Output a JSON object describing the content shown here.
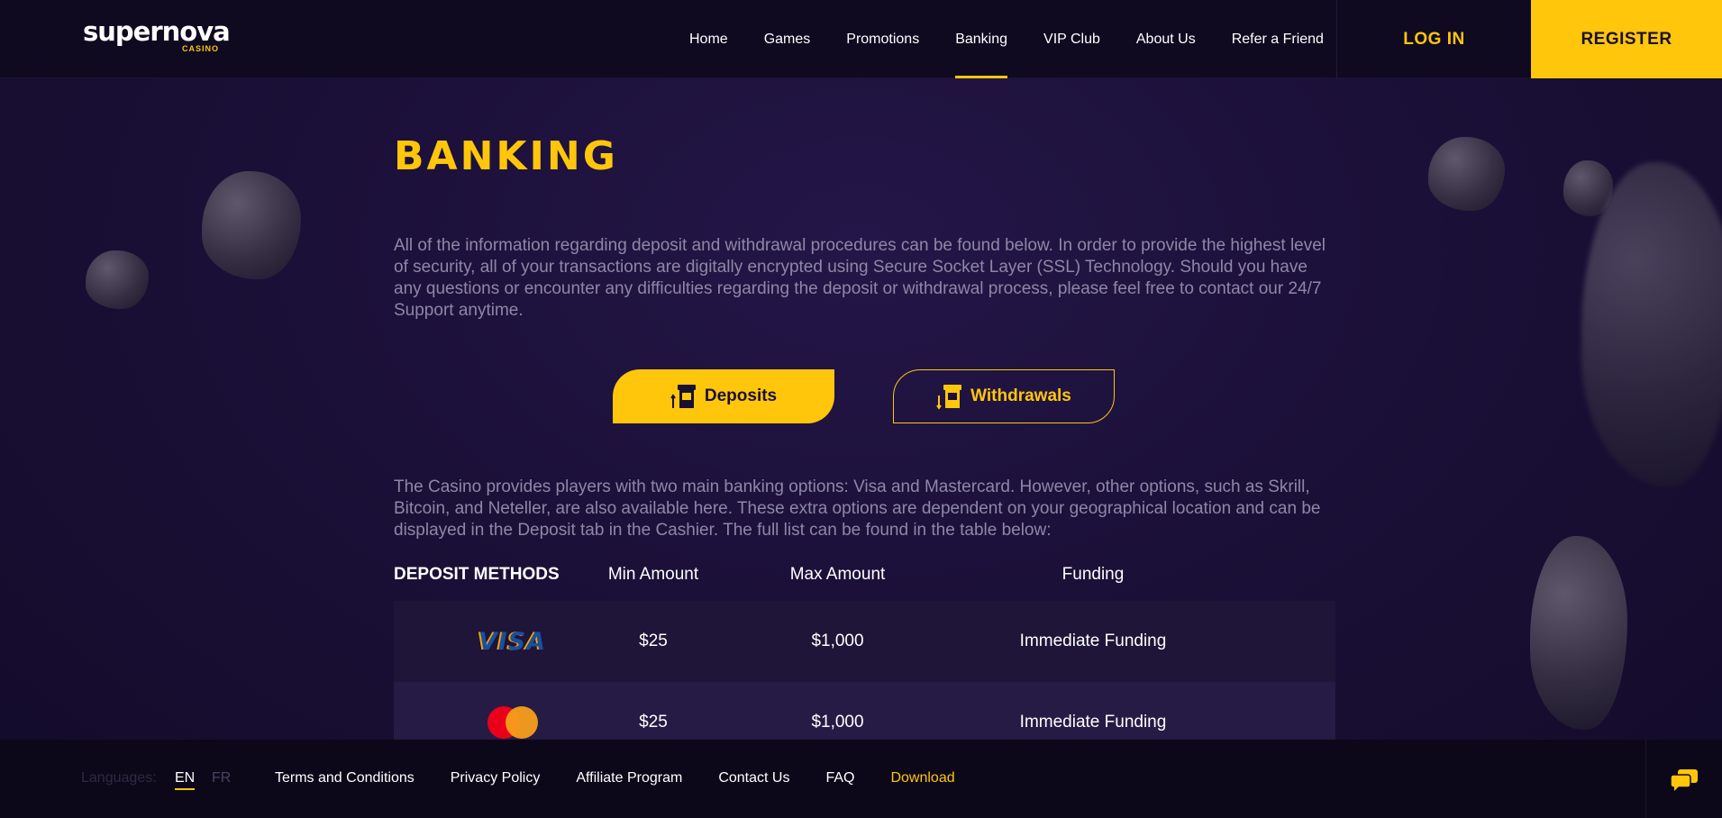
{
  "brand": {
    "logo_main": "supernova",
    "logo_sub": "CASINO",
    "accent_color": "#ffc60b",
    "background_color": "#1b1038"
  },
  "nav": {
    "items": [
      {
        "label": "Home"
      },
      {
        "label": "Games"
      },
      {
        "label": "Promotions"
      },
      {
        "label": "Banking",
        "active": true
      },
      {
        "label": "VIP Club"
      },
      {
        "label": "About Us"
      },
      {
        "label": "Refer a Friend"
      }
    ],
    "login_label": "LOG IN",
    "register_label": "REGISTER"
  },
  "page": {
    "title": "BANKING",
    "intro": "All of the information regarding deposit and withdrawal procedures can be found below. In order to provide the highest level of security, all of your transactions are digitally encrypted using Secure Socket Layer (SSL) Technology. Should you have any questions or encounter any difficulties regarding the deposit or withdrawal process, please feel free to contact our 24/7 Support anytime.",
    "tabs": [
      {
        "label": "Deposits",
        "icon": "atm-deposit-icon",
        "active": true
      },
      {
        "label": "Withdrawals",
        "icon": "atm-withdrawal-icon",
        "active": false
      }
    ],
    "deposit_text": "The Casino provides players with two main banking options: Visa and Mastercard. However, other options, such as Skrill, Bitcoin, and Neteller, are also available here. These extra options are dependent on your geographical location and can be displayed in the Deposit tab in the Cashier. The full list can be found in the table below:"
  },
  "table": {
    "headers": [
      "DEPOSIT METHODS",
      "Min Amount",
      "Max Amount",
      "Funding"
    ],
    "rows": [
      {
        "method": "VISA",
        "logo": "visa-logo",
        "min": "$25",
        "max": "$1,000",
        "funding": "Immediate Funding"
      },
      {
        "method": "mastercard",
        "logo": "mastercard-logo",
        "min": "$25",
        "max": "$1,000",
        "funding": "Immediate Funding"
      }
    ]
  },
  "footer": {
    "languages_label": "Languages:",
    "languages": [
      "EN",
      "FR"
    ],
    "active_language": "EN",
    "links": [
      "Terms and Conditions",
      "Privacy Policy",
      "Affiliate Program",
      "Contact Us",
      "FAQ",
      "Download"
    ],
    "chat_icon": "chat-bubbles-icon"
  }
}
